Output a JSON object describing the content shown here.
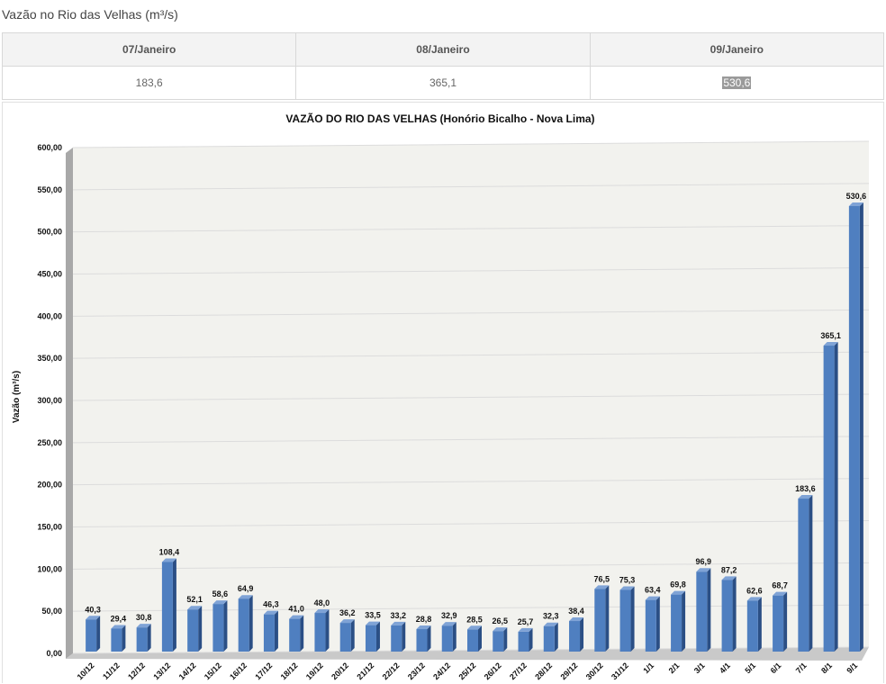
{
  "page_title": "Vazão no Rio das Velhas (m³/s)",
  "table": {
    "headers": [
      "07/Janeiro",
      "08/Janeiro",
      "09/Janeiro"
    ],
    "values": [
      "183,6",
      "365,1",
      "530,6"
    ]
  },
  "chart_data": {
    "type": "bar",
    "title": "VAZÃO DO RIO DAS VELHAS (Honório Bicalho - Nova Lima)",
    "ylabel": "Vazão  (m³/s)",
    "xlabel": "",
    "ylim": [
      0,
      600
    ],
    "ytick_labels": [
      "0,00",
      "50,00",
      "100,00",
      "150,00",
      "200,00",
      "250,00",
      "300,00",
      "350,00",
      "400,00",
      "450,00",
      "500,00",
      "550,00",
      "600,00"
    ],
    "categories": [
      "10/12",
      "11/12",
      "12/12",
      "13/12",
      "14/12",
      "15/12",
      "16/12",
      "17/12",
      "18/12",
      "19/12",
      "20/12",
      "21/12",
      "22/12",
      "23/12",
      "24/12",
      "25/12",
      "26/12",
      "27/12",
      "28/12",
      "29/12",
      "30/12",
      "31/12",
      "1/1",
      "2/1",
      "3/1",
      "4/1",
      "5/1",
      "6/1",
      "7/1",
      "8/1",
      "9/1"
    ],
    "values": [
      40.3,
      29.4,
      30.8,
      108.4,
      52.1,
      58.6,
      64.9,
      46.3,
      41.0,
      48.0,
      36.2,
      33.5,
      33.2,
      28.8,
      32.9,
      28.5,
      26.5,
      25.7,
      32.3,
      38.4,
      76.5,
      75.3,
      63.4,
      69.8,
      96.9,
      87.2,
      62.6,
      68.7,
      183.6,
      365.1,
      530.6
    ],
    "value_labels": [
      "40,3",
      "29,4",
      "30,8",
      "108,4",
      "52,1",
      "58,6",
      "64,9",
      "46,3",
      "41,0",
      "48,0",
      "36,2",
      "33,5",
      "33,2",
      "28,8",
      "32,9",
      "28,5",
      "26,5",
      "25,7",
      "32,3",
      "38,4",
      "76,5",
      "75,3",
      "63,4",
      "69,8",
      "96,9",
      "87,2",
      "62,6",
      "68,7",
      "183,6",
      "365,1",
      "530,6"
    ],
    "grid": true,
    "legend": "none",
    "colors": {
      "bar_front": "#4f7fc0",
      "bar_side": "#2b4f85",
      "bar_top": "#7fa3d6",
      "plot_bg": "#f2f2ee",
      "grid": "#dcdcdc"
    }
  }
}
